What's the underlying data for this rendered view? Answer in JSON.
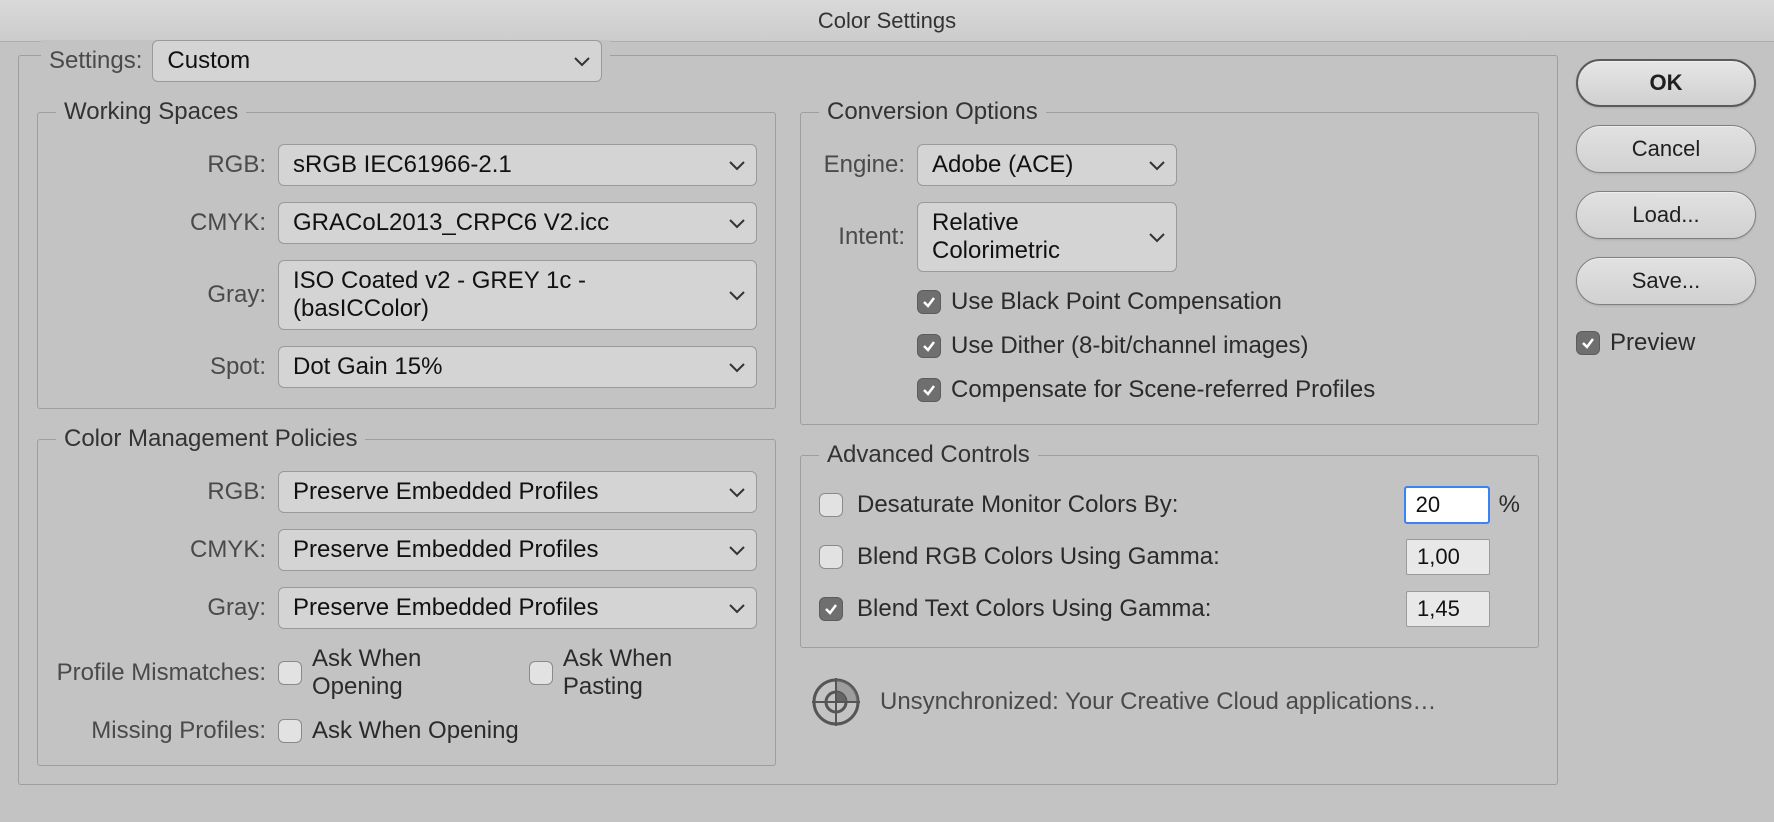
{
  "window": {
    "title": "Color Settings"
  },
  "settings": {
    "label": "Settings:",
    "value": "Custom"
  },
  "workingSpaces": {
    "legend": "Working Spaces",
    "rgb": {
      "label": "RGB:",
      "value": "sRGB IEC61966-2.1"
    },
    "cmyk": {
      "label": "CMYK:",
      "value": "GRACoL2013_CRPC6 V2.icc"
    },
    "gray": {
      "label": "Gray:",
      "value": "ISO Coated v2 - GREY 1c - (basICColor)"
    },
    "spot": {
      "label": "Spot:",
      "value": "Dot Gain 15%"
    }
  },
  "policies": {
    "legend": "Color Management Policies",
    "rgb": {
      "label": "RGB:",
      "value": "Preserve Embedded Profiles"
    },
    "cmyk": {
      "label": "CMYK:",
      "value": "Preserve Embedded Profiles"
    },
    "gray": {
      "label": "Gray:",
      "value": "Preserve Embedded Profiles"
    },
    "mismatch": {
      "label": "Profile Mismatches:",
      "opt1": "Ask When Opening",
      "opt2": "Ask When Pasting"
    },
    "missing": {
      "label": "Missing Profiles:",
      "opt1": "Ask When Opening"
    }
  },
  "conversion": {
    "legend": "Conversion Options",
    "engine": {
      "label": "Engine:",
      "value": "Adobe (ACE)"
    },
    "intent": {
      "label": "Intent:",
      "value": "Relative Colorimetric"
    },
    "bpc": "Use Black Point Compensation",
    "dither": "Use Dither (8-bit/channel images)",
    "scene": "Compensate for Scene-referred Profiles"
  },
  "advanced": {
    "legend": "Advanced Controls",
    "desat": {
      "label": "Desaturate Monitor Colors By:",
      "value": "20",
      "unit": "%"
    },
    "blendRGB": {
      "label": "Blend RGB Colors Using Gamma:",
      "value": "1,00"
    },
    "blendText": {
      "label": "Blend Text Colors Using Gamma:",
      "value": "1,45"
    }
  },
  "syncStatus": "Unsynchronized: Your Creative Cloud applications…",
  "buttons": {
    "ok": "OK",
    "cancel": "Cancel",
    "load": "Load...",
    "save": "Save..."
  },
  "preview": "Preview"
}
